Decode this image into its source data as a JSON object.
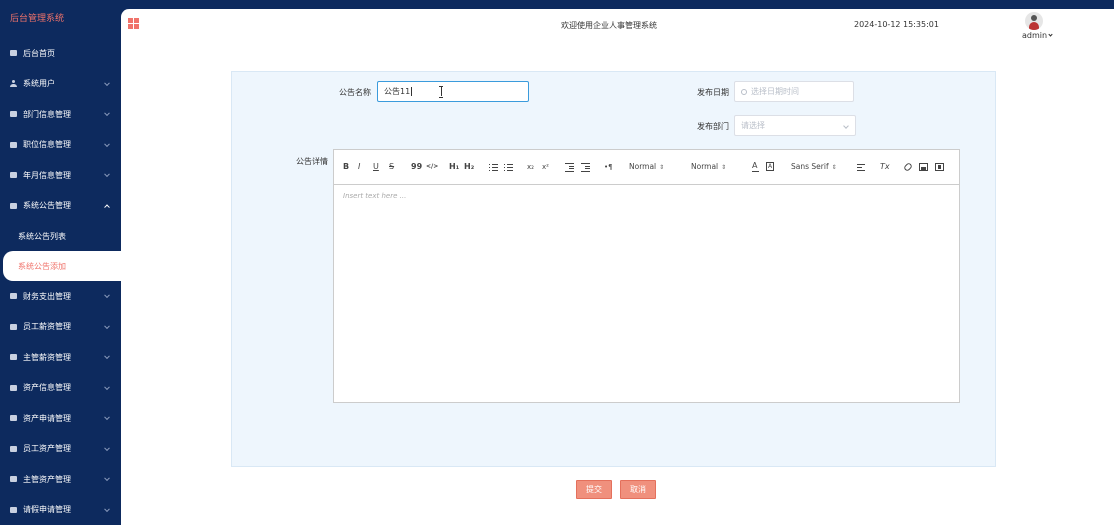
{
  "sidebar": {
    "brand": "后台管理系统",
    "items": [
      {
        "label": "后台首页",
        "icon": "monitor-icon"
      },
      {
        "label": "系统用户",
        "icon": "person-icon"
      },
      {
        "label": "部门信息管理",
        "icon": "doc-icon"
      },
      {
        "label": "职位信息管理",
        "icon": "doc-icon"
      },
      {
        "label": "年月信息管理",
        "icon": "doc-icon"
      },
      {
        "label": "系统公告管理",
        "icon": "doc-icon"
      }
    ],
    "submenu": [
      {
        "label": "系统公告列表"
      },
      {
        "label": "系统公告添加"
      }
    ],
    "items_after": [
      {
        "label": "财务支出管理"
      },
      {
        "label": "员工薪资管理"
      },
      {
        "label": "主管薪资管理"
      },
      {
        "label": "资产信息管理"
      },
      {
        "label": "资产申请管理"
      },
      {
        "label": "员工资产管理"
      },
      {
        "label": "主管资产管理"
      },
      {
        "label": "请假申请管理"
      }
    ]
  },
  "header": {
    "welcome": "欢迎使用企业人事管理系统",
    "datetime": "2024-10-12 15:35:01",
    "username": "admin"
  },
  "form": {
    "title_label": "公告名称",
    "title_value": "公告11",
    "date_label": "发布日期",
    "date_placeholder": "选择日期时间",
    "dept_label": "发布部门",
    "dept_placeholder": "请选择",
    "detail_label": "公告详情",
    "editor_placeholder": "Insert text here ..."
  },
  "toolbar": {
    "bold": "B",
    "italic": "I",
    "underline": "U",
    "strike": "S",
    "quote": "99",
    "code": "</>",
    "h1": "H₁",
    "h2": "H₂",
    "sub": "x₂",
    "sup": "x²",
    "indent": "•¶",
    "size": "Normal",
    "header": "Normal",
    "font": "Sans Serif",
    "clean": "Tx"
  },
  "buttons": {
    "submit": "提交",
    "cancel": "取消"
  },
  "colors": {
    "accent": "#f0736b",
    "sidebar_bg": "#0d2a5e",
    "button": "#f0907d",
    "form_bg": "#eef6fd"
  }
}
